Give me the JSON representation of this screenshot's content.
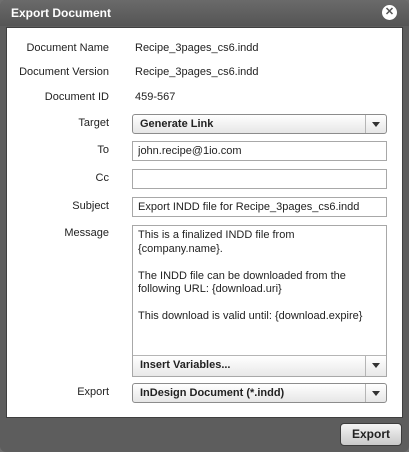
{
  "dialog": {
    "title": "Export Document",
    "close_icon": "close-icon"
  },
  "info": {
    "document_name_label": "Document Name",
    "document_name": "Recipe_3pages_cs6.indd",
    "document_version_label": "Document Version",
    "document_version": "Recipe_3pages_cs6.indd",
    "document_id_label": "Document ID",
    "document_id": "459-567"
  },
  "form": {
    "target_label": "Target",
    "target_value": "Generate Link",
    "to_label": "To",
    "to_value": "john.recipe@1io.com",
    "cc_label": "Cc",
    "cc_value": "",
    "subject_label": "Subject",
    "subject_value": "Export INDD file for Recipe_3pages_cs6.indd",
    "message_label": "Message",
    "message_value": "This is a finalized INDD file from\n{company.name}.\n\nThe INDD file can be downloaded from the\nfollowing URL: {download.uri}\n\nThis download is valid until: {download.expire}",
    "insert_variables_label": "Insert Variables...",
    "export_label": "Export",
    "export_value": "InDesign Document (*.indd)"
  },
  "footer": {
    "export_button": "Export"
  }
}
